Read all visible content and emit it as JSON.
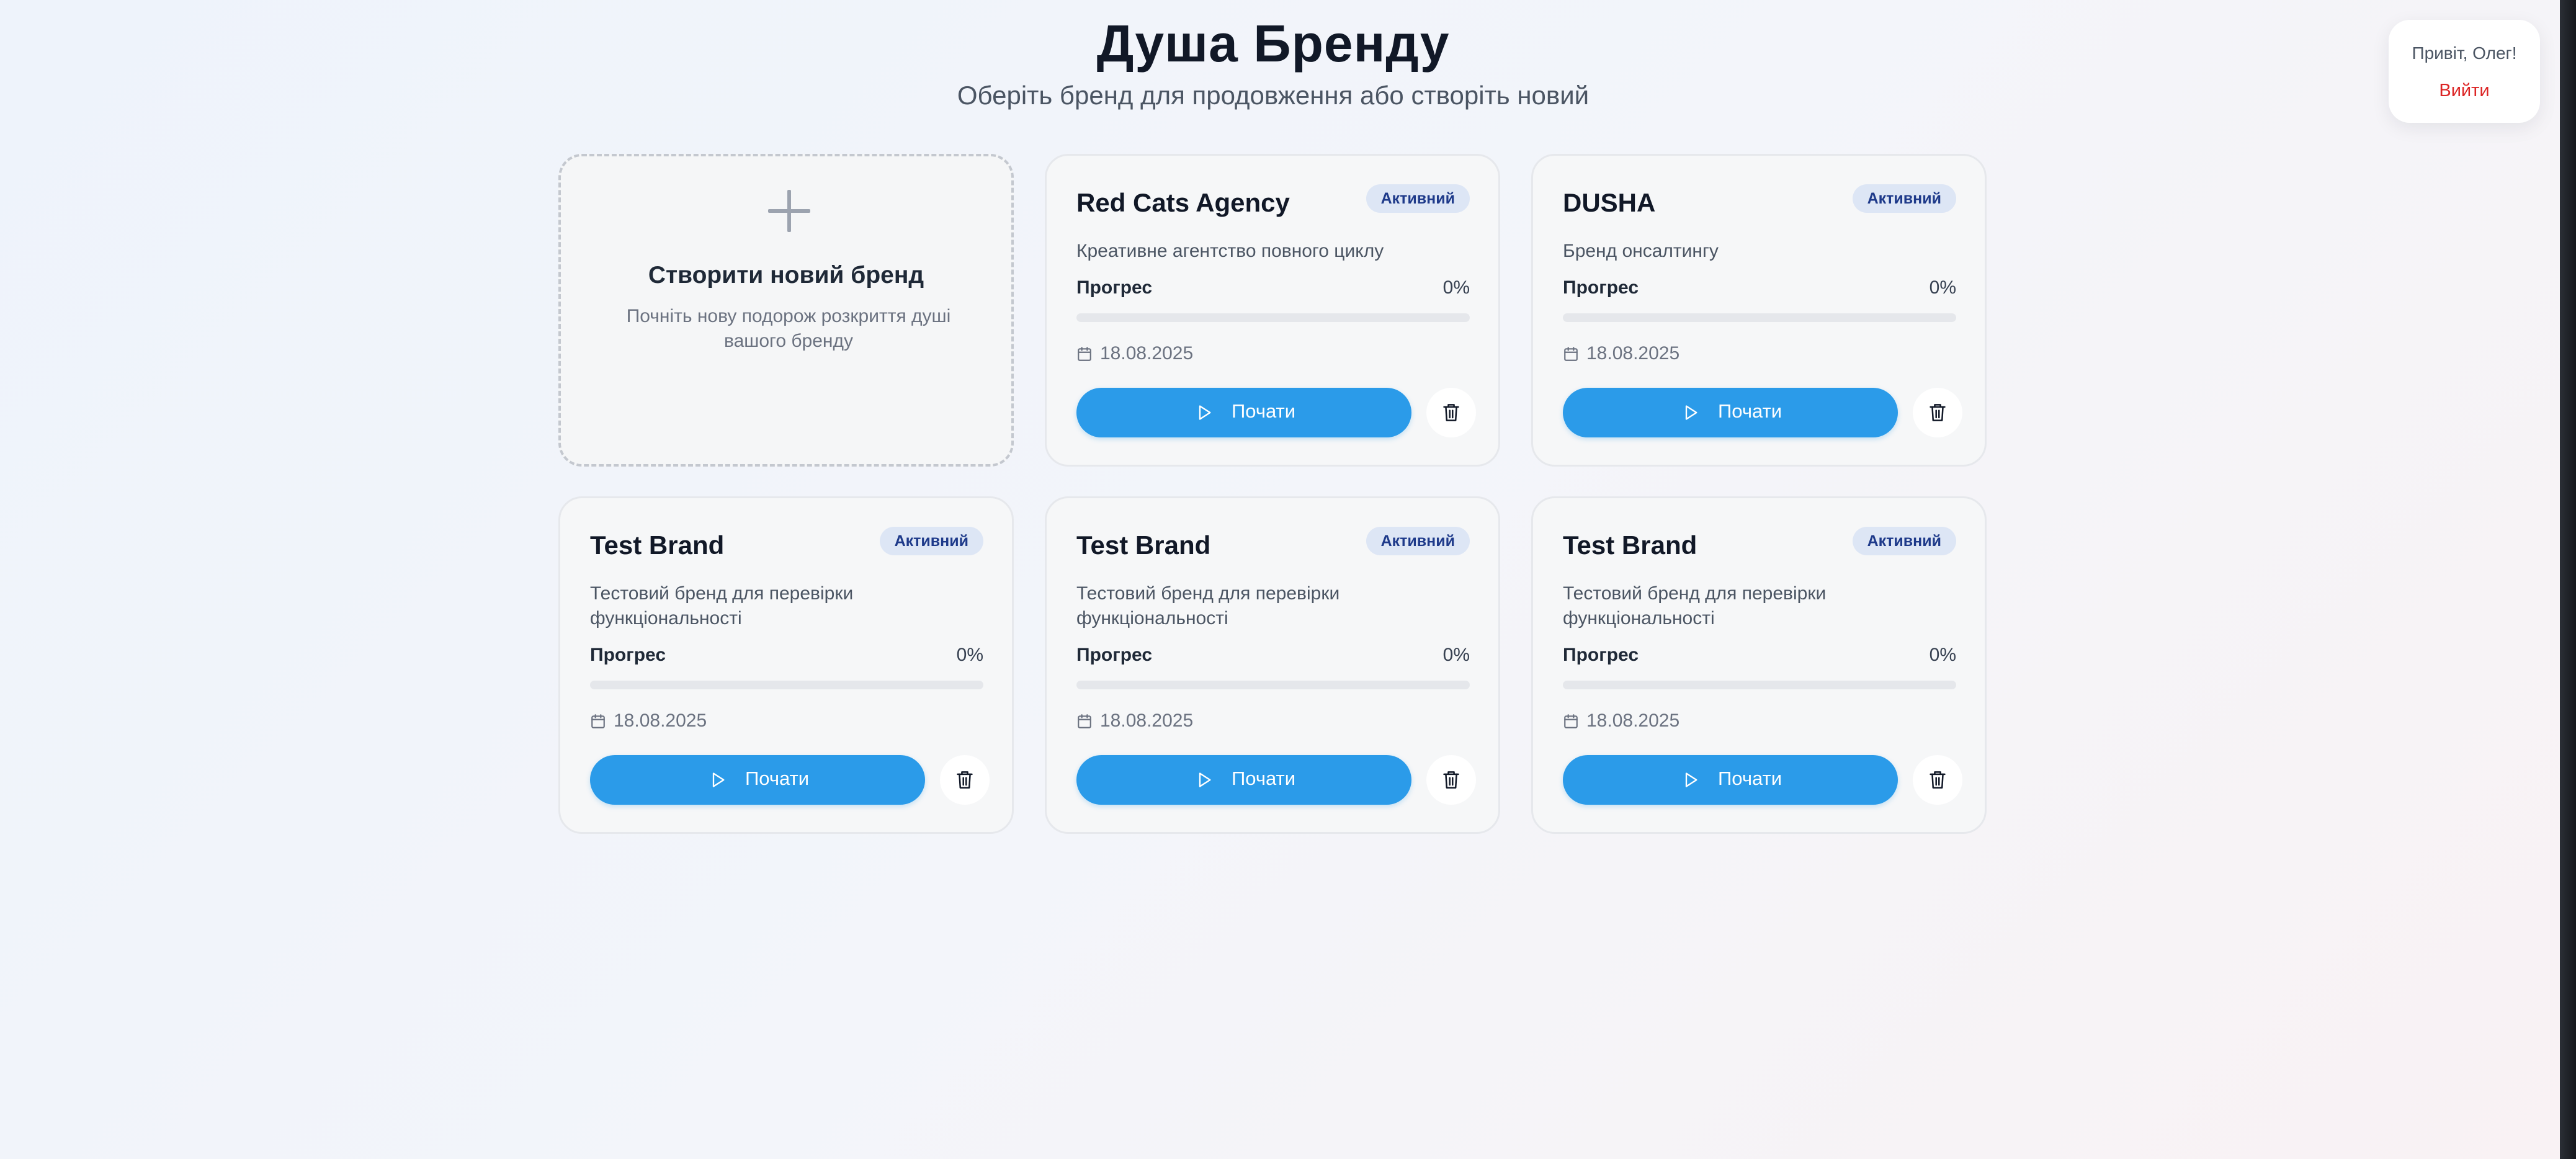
{
  "header": {
    "title": "Душа Бренду",
    "subtitle": "Оберіть бренд для продовження або створіть новий"
  },
  "user": {
    "greeting": "Привіт, Олег!",
    "logout_label": "Вийти"
  },
  "create_card": {
    "icon": "plus-icon",
    "title": "Створити новий бренд",
    "description": "Почніть нову подорож розкриття душі вашого бренду"
  },
  "brands": [
    {
      "title": "Red Cats Agency",
      "status": "Активний",
      "description": "Креативне агентство повного циклу",
      "progress_label": "Прогрес",
      "progress_value": "0%",
      "progress_fraction": 0,
      "date": "18.08.2025",
      "start_label": "Почати"
    },
    {
      "title": "DUSHA",
      "status": "Активний",
      "description": "Бренд онсалтингу",
      "progress_label": "Прогрес",
      "progress_value": "0%",
      "progress_fraction": 0,
      "date": "18.08.2025",
      "start_label": "Почати"
    },
    {
      "title": "Test Brand",
      "status": "Активний",
      "description": "Тестовий бренд для перевірки функціональності",
      "progress_label": "Прогрес",
      "progress_value": "0%",
      "progress_fraction": 0,
      "date": "18.08.2025",
      "start_label": "Почати"
    },
    {
      "title": "Test Brand",
      "status": "Активний",
      "description": "Тестовий бренд для перевірки функціональності",
      "progress_label": "Прогрес",
      "progress_value": "0%",
      "progress_fraction": 0,
      "date": "18.08.2025",
      "start_label": "Почати"
    },
    {
      "title": "Test Brand",
      "status": "Активний",
      "description": "Тестовий бренд для перевірки функціональності",
      "progress_label": "Прогрес",
      "progress_value": "0%",
      "progress_fraction": 0,
      "date": "18.08.2025",
      "start_label": "Почати"
    }
  ],
  "colors": {
    "accent": "#2b9be9",
    "logout": "#dc2626",
    "badge_bg": "#dde6f5",
    "badge_text": "#1e3a8a"
  }
}
